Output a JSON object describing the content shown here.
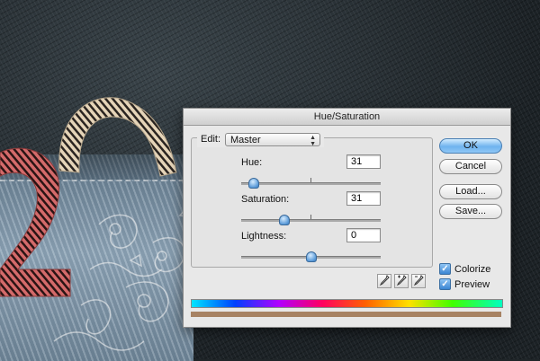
{
  "dialog": {
    "title": "Hue/Saturation",
    "edit_label": "Edit:",
    "edit_value": "Master",
    "hue": {
      "label": "Hue:",
      "value": "31"
    },
    "saturation": {
      "label": "Saturation:",
      "value": "31"
    },
    "lightness": {
      "label": "Lightness:",
      "value": "0"
    },
    "buttons": {
      "ok": "OK",
      "cancel": "Cancel",
      "load": "Load...",
      "save": "Save..."
    },
    "colorize": {
      "label": "Colorize",
      "checked": true
    },
    "preview": {
      "label": "Preview",
      "checked": true
    },
    "icons": [
      "eyedropper-icon",
      "eyedropper-plus-icon",
      "eyedropper-minus-icon"
    ],
    "result_color": "#a78263"
  },
  "colors": {
    "accent": "#5b9bd9",
    "dialog_bg": "#e8e8e8"
  }
}
